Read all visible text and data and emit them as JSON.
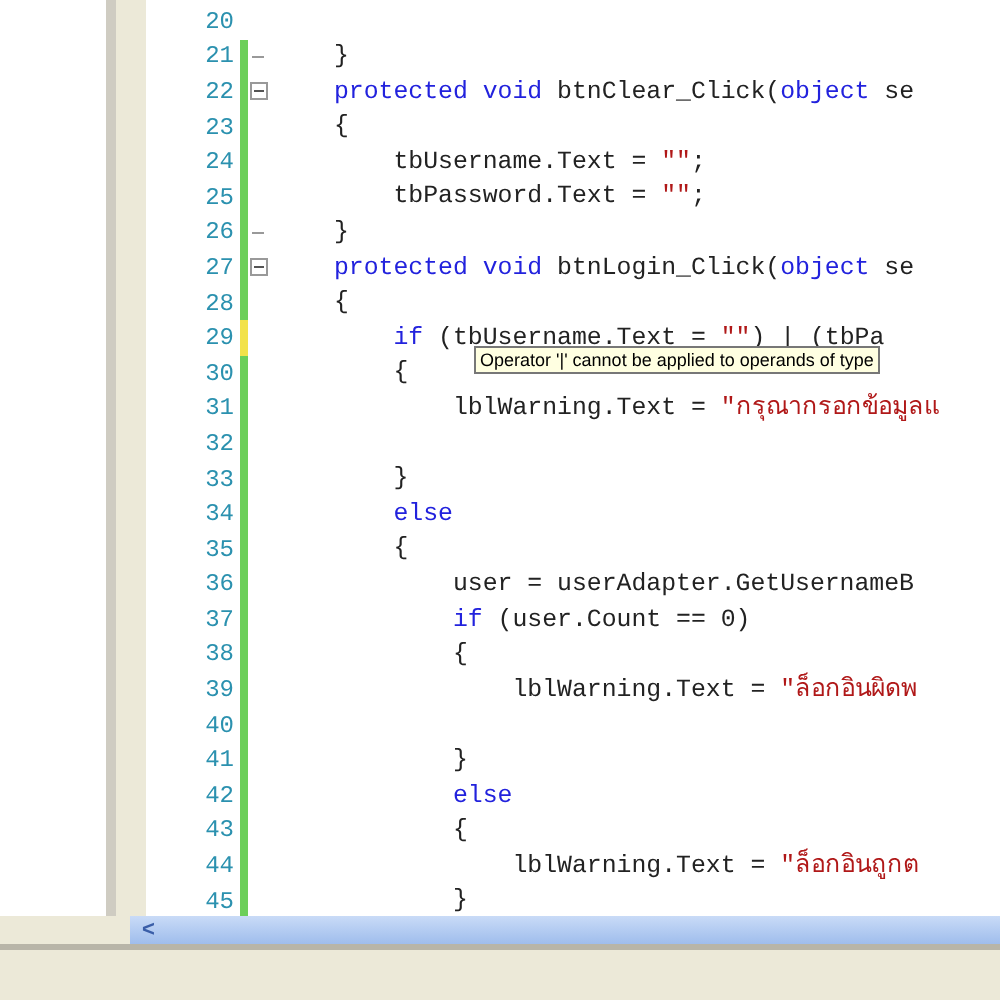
{
  "editor": {
    "lines": [
      {
        "number": "20",
        "collapsible": false,
        "block_end": false
      },
      {
        "number": "21",
        "color": "#6ccf5a",
        "collapsible": false,
        "block_end": true,
        "tokens": [
          {
            "kind": "plain",
            "text": "}"
          }
        ]
      },
      {
        "number": "22",
        "color": "#6ccf5a",
        "collapsible": true,
        "block_end": false,
        "tokens": [
          {
            "kind": "keyword",
            "text": "protected void"
          },
          {
            "kind": "plain",
            "text": " btnClear_Click("
          },
          {
            "kind": "keyword",
            "text": "object"
          },
          {
            "kind": "plain",
            "text": " se"
          }
        ]
      },
      {
        "number": "23",
        "color": "#6ccf5a",
        "collapsible": false,
        "block_end": false,
        "tokens": [
          {
            "kind": "plain",
            "text": "{"
          }
        ]
      },
      {
        "number": "24",
        "color": "#6ccf5a",
        "collapsible": false,
        "block_end": false,
        "tokens": [
          {
            "kind": "plain",
            "text": "    tbUsername.Text = "
          },
          {
            "kind": "string",
            "text": "\"\""
          },
          {
            "kind": "plain",
            "text": ";"
          }
        ]
      },
      {
        "number": "25",
        "color": "#6ccf5a",
        "collapsible": false,
        "block_end": false,
        "tokens": [
          {
            "kind": "plain",
            "text": "    tbPassword.Text = "
          },
          {
            "kind": "string",
            "text": "\"\""
          },
          {
            "kind": "plain",
            "text": ";"
          }
        ]
      },
      {
        "number": "26",
        "color": "#6ccf5a",
        "collapsible": false,
        "block_end": true,
        "tokens": [
          {
            "kind": "plain",
            "text": "}"
          }
        ]
      },
      {
        "number": "27",
        "color": "#6ccf5a",
        "collapsible": true,
        "block_end": false,
        "tokens": [
          {
            "kind": "keyword",
            "text": "protected void"
          },
          {
            "kind": "plain",
            "text": " btnLogin_Click("
          },
          {
            "kind": "keyword",
            "text": "object"
          },
          {
            "kind": "plain",
            "text": " se"
          }
        ]
      },
      {
        "number": "28",
        "color": "#6ccf5a",
        "collapsible": false,
        "block_end": false,
        "tokens": [
          {
            "kind": "plain",
            "text": "{"
          }
        ]
      },
      {
        "number": "29",
        "color": "#f2e24a",
        "collapsible": false,
        "block_end": false,
        "tokens": [
          {
            "kind": "keyword",
            "text": "    if"
          },
          {
            "kind": "plain",
            "text": " (tbUsername.Text = "
          },
          {
            "kind": "string",
            "text": "\"\""
          },
          {
            "kind": "plain",
            "text": ") | (tbPa"
          }
        ]
      },
      {
        "number": "30",
        "color": "#6ccf5a",
        "collapsible": false,
        "block_end": false,
        "tokens": [
          {
            "kind": "plain",
            "text": "    {"
          }
        ]
      },
      {
        "number": "31",
        "color": "#6ccf5a",
        "collapsible": false,
        "block_end": false,
        "tokens": [
          {
            "kind": "plain",
            "text": "        lblWarning.Text = "
          },
          {
            "kind": "string",
            "text": "\"กรุณากรอกข้อมูลแ"
          }
        ]
      },
      {
        "number": "32",
        "color": "#6ccf5a",
        "collapsible": false,
        "block_end": false
      },
      {
        "number": "33",
        "color": "#6ccf5a",
        "collapsible": false,
        "block_end": false,
        "tokens": [
          {
            "kind": "plain",
            "text": "    }"
          }
        ]
      },
      {
        "number": "34",
        "color": "#6ccf5a",
        "collapsible": false,
        "block_end": false,
        "tokens": [
          {
            "kind": "keyword",
            "text": "    else"
          }
        ]
      },
      {
        "number": "35",
        "color": "#6ccf5a",
        "collapsible": false,
        "block_end": false,
        "tokens": [
          {
            "kind": "plain",
            "text": "    {"
          }
        ]
      },
      {
        "number": "36",
        "color": "#6ccf5a",
        "collapsible": false,
        "block_end": false,
        "tokens": [
          {
            "kind": "plain",
            "text": "        user = userAdapter.GetUsernameB"
          }
        ]
      },
      {
        "number": "37",
        "color": "#6ccf5a",
        "collapsible": false,
        "block_end": false,
        "tokens": [
          {
            "kind": "keyword",
            "text": "        if"
          },
          {
            "kind": "plain",
            "text": " (user.Count == 0)"
          }
        ]
      },
      {
        "number": "38",
        "color": "#6ccf5a",
        "collapsible": false,
        "block_end": false,
        "tokens": [
          {
            "kind": "plain",
            "text": "        {"
          }
        ]
      },
      {
        "number": "39",
        "color": "#6ccf5a",
        "collapsible": false,
        "block_end": false,
        "tokens": [
          {
            "kind": "plain",
            "text": "            lblWarning.Text = "
          },
          {
            "kind": "string",
            "text": "\"ล็อกอินผิดพ"
          }
        ]
      },
      {
        "number": "40",
        "color": "#6ccf5a",
        "collapsible": false,
        "block_end": false
      },
      {
        "number": "41",
        "color": "#6ccf5a",
        "collapsible": false,
        "block_end": false,
        "tokens": [
          {
            "kind": "plain",
            "text": "        }"
          }
        ]
      },
      {
        "number": "42",
        "color": "#6ccf5a",
        "collapsible": false,
        "block_end": false,
        "tokens": [
          {
            "kind": "keyword",
            "text": "        else"
          }
        ]
      },
      {
        "number": "43",
        "color": "#6ccf5a",
        "collapsible": false,
        "block_end": false,
        "tokens": [
          {
            "kind": "plain",
            "text": "        {"
          }
        ]
      },
      {
        "number": "44",
        "color": "#6ccf5a",
        "collapsible": false,
        "block_end": false,
        "tokens": [
          {
            "kind": "plain",
            "text": "            lblWarning.Text = "
          },
          {
            "kind": "string",
            "text": "\"ล็อกอินถูกต"
          }
        ]
      },
      {
        "number": "45",
        "color": "#6ccf5a",
        "collapsible": false,
        "block_end": false,
        "tokens": [
          {
            "kind": "plain",
            "text": "        }"
          }
        ]
      }
    ],
    "tooltip": {
      "text": "Operator '|' cannot be applied to operands of type"
    },
    "scrollbar": {
      "arrow": "<"
    }
  }
}
